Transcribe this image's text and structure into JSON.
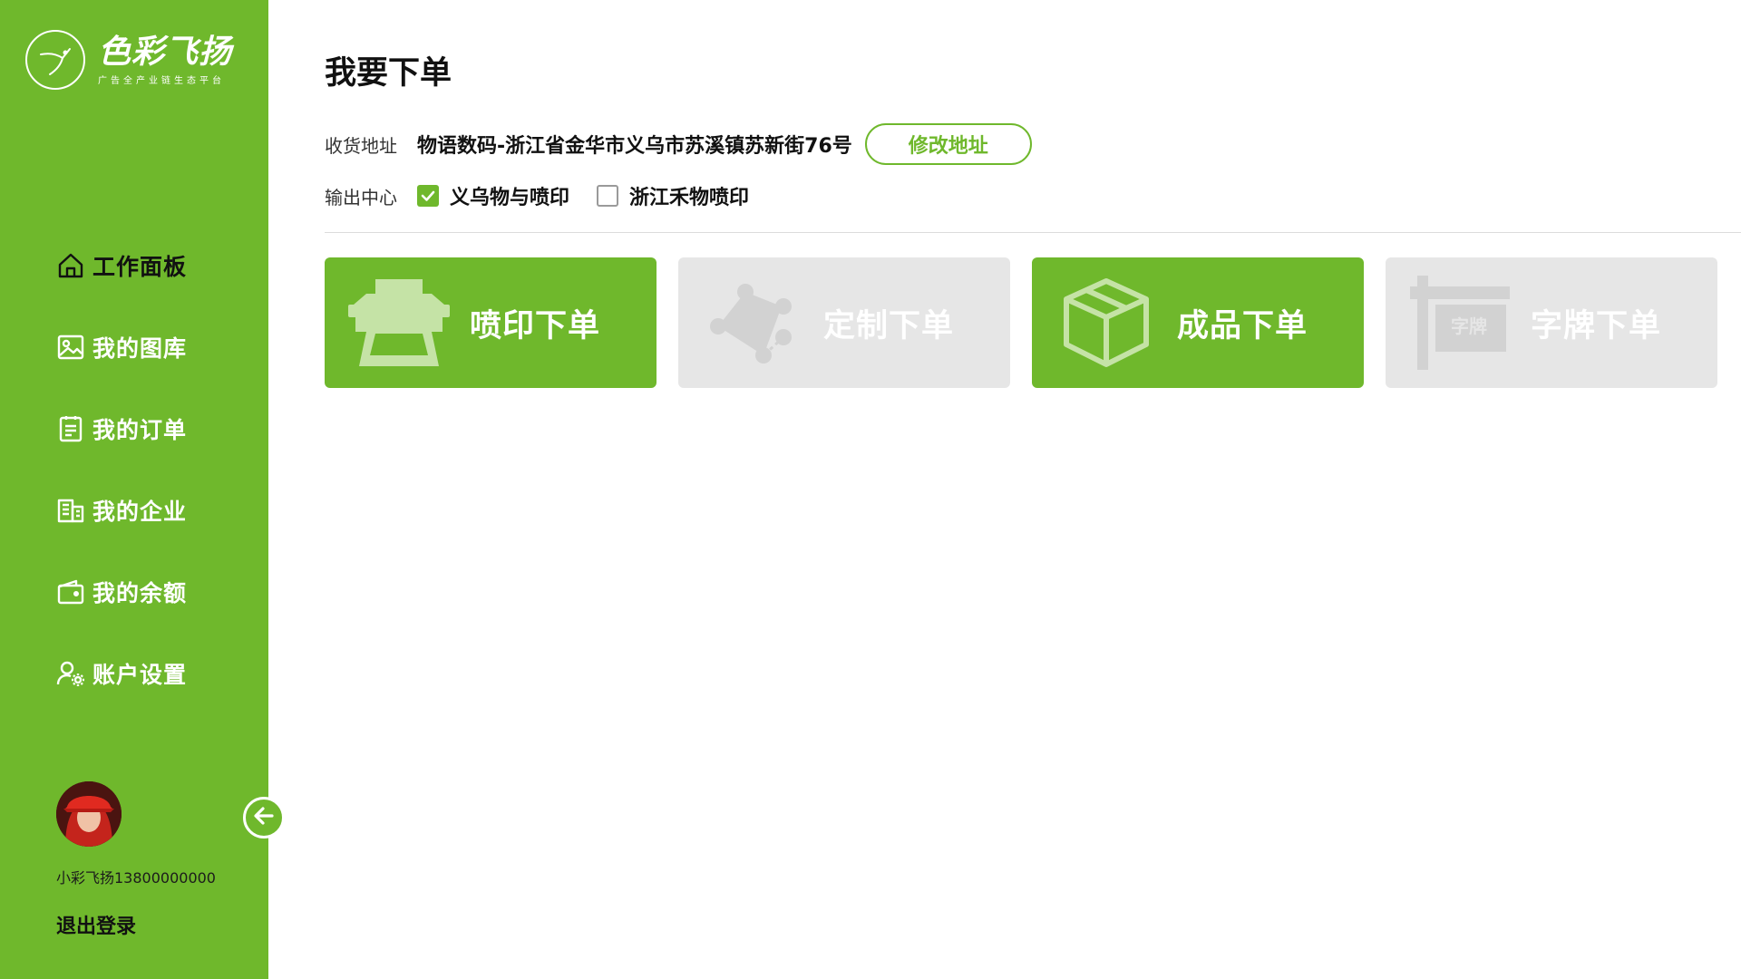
{
  "brand": {
    "name": "色彩飞扬",
    "tagline": "广告全产业链生态平台"
  },
  "nav": [
    {
      "label": "工作面板",
      "icon": "home-icon",
      "active": true
    },
    {
      "label": "我的图库",
      "icon": "image-icon"
    },
    {
      "label": "我的订单",
      "icon": "order-list-icon"
    },
    {
      "label": "我的企业",
      "icon": "building-icon"
    },
    {
      "label": "我的余额",
      "icon": "wallet-icon"
    },
    {
      "label": "账户设置",
      "icon": "user-settings-icon"
    }
  ],
  "user": {
    "name": "小彩飞扬13800000000",
    "logout_label": "退出登录"
  },
  "page": {
    "title": "我要下单",
    "address_label": "收货地址",
    "address_value": "物语数码-浙江省金华市义乌市苏溪镇苏新街76号",
    "edit_address_label": "修改地址",
    "output_center_label": "输出中心",
    "output_centers": [
      {
        "label": "义乌物与喷印",
        "checked": true
      },
      {
        "label": "浙江禾物喷印",
        "checked": false
      }
    ]
  },
  "order_cards": [
    {
      "label": "喷印下单",
      "icon": "printer-icon",
      "enabled": true
    },
    {
      "label": "定制下单",
      "icon": "custom-shape-icon",
      "enabled": false
    },
    {
      "label": "成品下单",
      "icon": "box-icon",
      "enabled": true
    },
    {
      "label": "字牌下单",
      "icon": "sign-board-icon",
      "enabled": false,
      "icon_text": "字牌"
    }
  ],
  "colors": {
    "accent": "#6fb82c",
    "disabled": "#e6e6e6"
  }
}
